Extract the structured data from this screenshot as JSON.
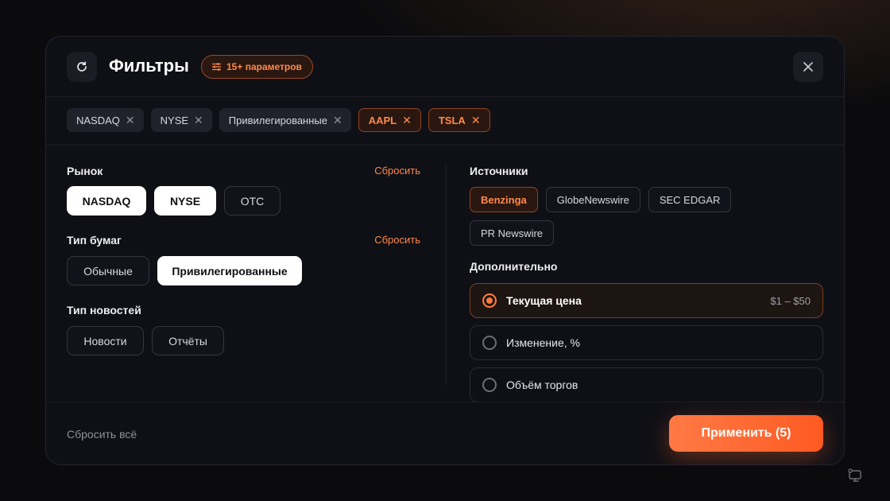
{
  "header": {
    "title": "Фильтры",
    "params_badge": "15+ параметров"
  },
  "active_chips": [
    {
      "label": "NASDAQ",
      "remove": "✕"
    },
    {
      "label": "NYSE",
      "remove": "✕"
    },
    {
      "label": "Привилегированные",
      "remove": "✕"
    },
    {
      "label": "AAPL",
      "remove": "✕"
    },
    {
      "label": "TSLA",
      "remove": "✕"
    }
  ],
  "market": {
    "label": "Рынок",
    "reset": "Сбросить",
    "options": [
      {
        "label": "NASDAQ",
        "selected": true
      },
      {
        "label": "NYSE",
        "selected": true
      },
      {
        "label": "OTC",
        "selected": false
      }
    ]
  },
  "security_type": {
    "label": "Тип бумаг",
    "reset": "Сбросить",
    "options": [
      {
        "label": "Обычные",
        "selected": false
      },
      {
        "label": "Привилегированные",
        "selected": true
      }
    ]
  },
  "news_type": {
    "label": "Тип новостей",
    "options": [
      {
        "label": "Новости",
        "selected": false
      },
      {
        "label": "Отчёты",
        "selected": false
      }
    ]
  },
  "sources": {
    "label": "Источники",
    "options": [
      {
        "label": "Benzinga",
        "selected": true
      },
      {
        "label": "GlobeNewswire",
        "selected": false
      },
      {
        "label": "SEC EDGAR",
        "selected": false
      },
      {
        "label": "PR Newswire",
        "selected": false
      }
    ]
  },
  "additional": {
    "label": "Дополнительно",
    "items": [
      {
        "label": "Текущая цена",
        "value": "$1 – $50",
        "selected": true
      },
      {
        "label": "Изменение, %",
        "value": "",
        "selected": false
      },
      {
        "label": "Объём торгов",
        "value": "",
        "selected": false
      }
    ]
  },
  "footer": {
    "reset_all": "Сбросить всё",
    "apply": "Применить (5)"
  },
  "colors": {
    "accent": "#ff7a3a",
    "background": "#0b0b0d",
    "panel": "#0f1016"
  }
}
